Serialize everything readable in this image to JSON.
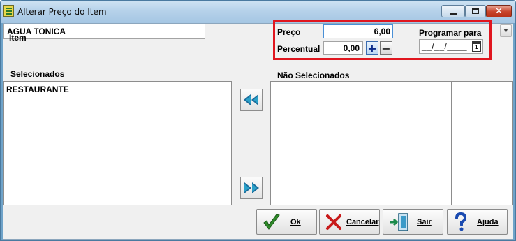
{
  "window": {
    "title": "Alterar Preço do Item"
  },
  "item": {
    "label": "Item",
    "value": "AGUA TONICA"
  },
  "pricing": {
    "preco_label": "Preço",
    "preco_value": "6,00",
    "percentual_label": "Percentual",
    "percentual_value": "0,00",
    "plus": "+",
    "minus": "−",
    "programar_label": "Programar para",
    "date_value": "__/__/____",
    "calendar_day": "1"
  },
  "lists": {
    "selecionados_label": "Selecionados",
    "selecionados_items": [
      "RESTAURANTE"
    ],
    "nao_selecionados_label": "Não Selecionados"
  },
  "buttons": {
    "ok": "Ok",
    "cancel": "Cancelar",
    "exit": "Sair",
    "help": "Ajuda"
  },
  "colors": {
    "highlight": "#e0161f",
    "titlebar": "#b6d2ea",
    "arrow": "#1a6b9a"
  }
}
